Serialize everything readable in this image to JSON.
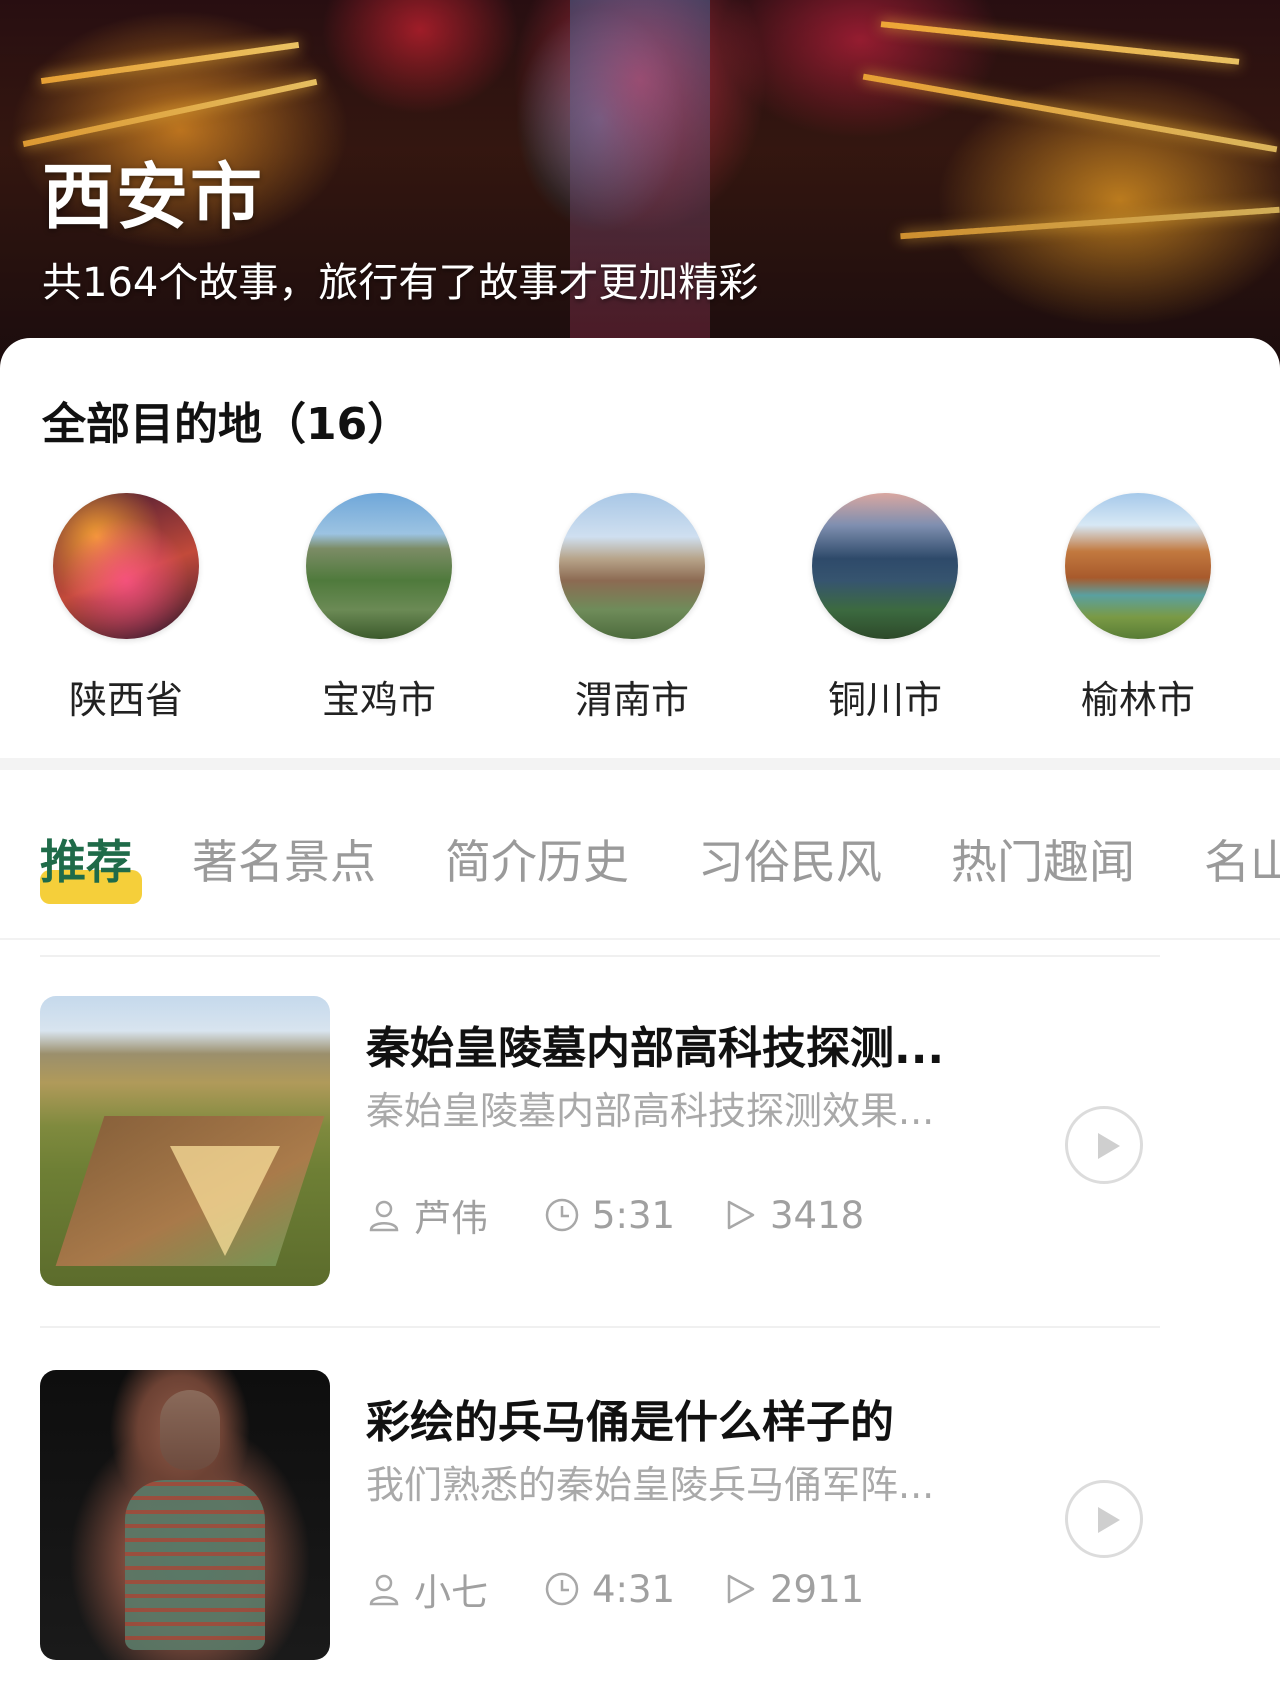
{
  "hero": {
    "title": "西安市",
    "subtitle": "共164个故事，旅行有了故事才更加精彩"
  },
  "destinations": {
    "title": "全部目的地（16）",
    "items": [
      {
        "label": "陕西省",
        "thumb": "night-palace-photo"
      },
      {
        "label": "宝鸡市",
        "thumb": "city-aerial-photo"
      },
      {
        "label": "渭南市",
        "thumb": "town-street-photo"
      },
      {
        "label": "铜川市",
        "thumb": "dusk-city-photo"
      },
      {
        "label": "榆林市",
        "thumb": "red-canyon-photo"
      }
    ]
  },
  "tabs": {
    "items": [
      "推荐",
      "著名景点",
      "简介历史",
      "习俗民风",
      "热门趣闻",
      "名山"
    ],
    "active_index": 0
  },
  "stories": [
    {
      "title": "秦始皇陵墓内部高科技探测...",
      "desc": "秦始皇陵墓内部高科技探测效果...",
      "author": "芦伟",
      "duration": "5:31",
      "plays": "3418",
      "thumb": "mausoleum-aerial-photo"
    },
    {
      "title": "彩绘的兵马俑是什么样子的",
      "desc": "我们熟悉的秦始皇陵兵马俑军阵...",
      "author": "小七",
      "duration": "4:31",
      "plays": "2911",
      "thumb": "terracotta-warrior-photo"
    }
  ],
  "colors": {
    "accent_green": "#1f6b49",
    "tab_highlight": "#f5cf3a",
    "muted_text": "#a0a0a0"
  },
  "icons": {
    "author": "user-icon",
    "duration": "clock-icon",
    "plays": "play-count-icon",
    "play_button": "play-circle-icon"
  }
}
